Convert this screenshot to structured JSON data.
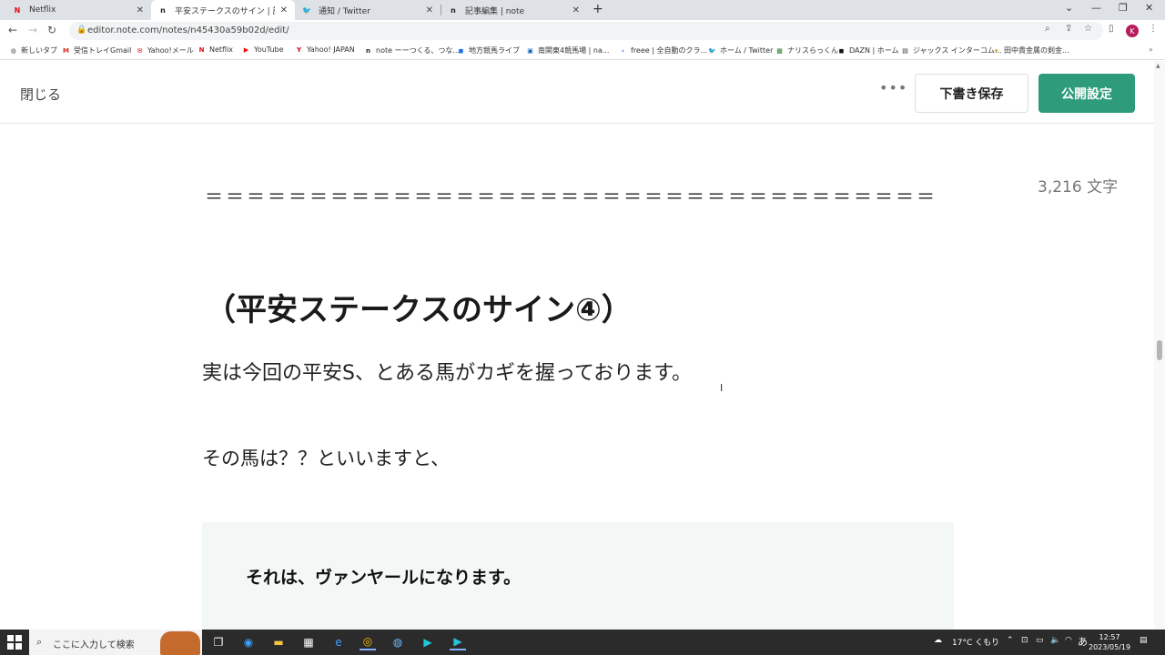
{
  "browser": {
    "tabs": [
      {
        "title": "Netflix",
        "icon": "netflix-icon",
        "active": false
      },
      {
        "title": "平安ステークスのサイン | 記事編集 | n",
        "icon": "note-icon",
        "active": true
      },
      {
        "title": "通知 / Twitter",
        "icon": "twitter-icon",
        "active": false
      },
      {
        "title": "記事編集 | note",
        "icon": "note-icon",
        "active": false
      }
    ],
    "url": "editor.note.com/notes/n45430a59b02d/edit/",
    "profile_initial": "K",
    "bookmarks": [
      {
        "label": "新しいタブ"
      },
      {
        "label": "受信トレイGmail"
      },
      {
        "label": "Yahoo!メール"
      },
      {
        "label": "Netflix"
      },
      {
        "label": "YouTube"
      },
      {
        "label": "Yahoo! JAPAN"
      },
      {
        "label": "note ーーつくる、つな..."
      },
      {
        "label": "地方競馬ライブ"
      },
      {
        "label": "南関東4競馬場 | na..."
      },
      {
        "label": "freee | 全自動のクラ..."
      },
      {
        "label": "ホーム / Twitter"
      },
      {
        "label": "ナリスらっくん"
      },
      {
        "label": "DAZN | ホーム"
      },
      {
        "label": "ジャックス インターコム..."
      },
      {
        "label": "田中貴金属の剣金..."
      }
    ]
  },
  "editor": {
    "close_label": "閉じる",
    "more_label": "•••",
    "draft_label": "下書き保存",
    "publish_label": "公開設定",
    "char_count": "3,216 文字",
    "divider": "＝＝＝＝＝＝＝＝＝＝＝＝＝＝＝＝＝＝＝＝＝＝＝＝＝＝＝＝＝＝＝＝＝＝＝",
    "heading": "（平安ステークスのサイン④）",
    "paragraph1": "実は今回の平安S、とある馬がカギを握っております。",
    "paragraph2": "その馬は？？といいますと、",
    "quote": "それは、ヴァンヤールになります。"
  },
  "taskbar": {
    "search_placeholder": "ここに入力して検索",
    "weather": "17°C くもり",
    "ime": "あ",
    "time": "12:57",
    "date": "2023/05/19"
  },
  "colors": {
    "publish": "#2e9c7a",
    "quote_bg": "#f3f8f7"
  }
}
